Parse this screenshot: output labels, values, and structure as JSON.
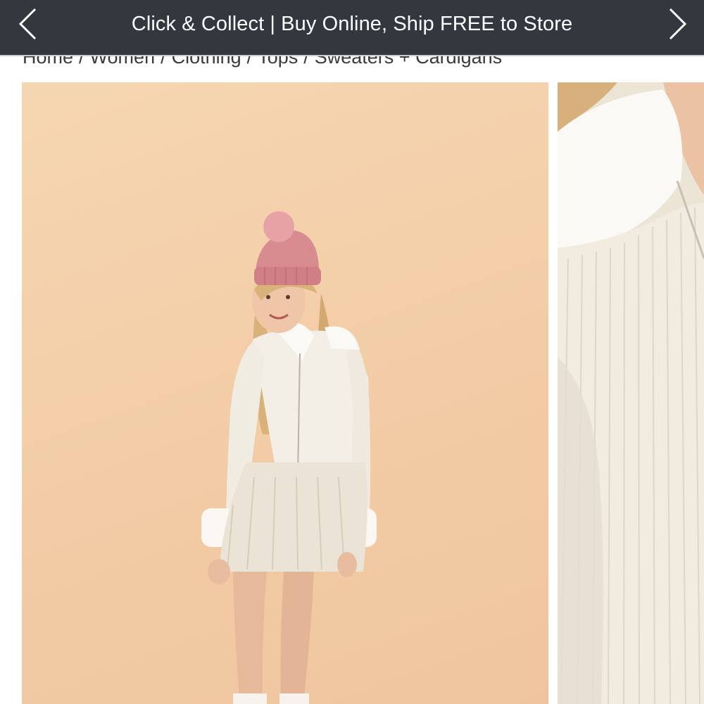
{
  "promo": {
    "text": "Click & Collect | Buy Online, Ship FREE to Store",
    "prev_icon": "chevron-left-icon",
    "next_icon": "chevron-right-icon",
    "background": "#33383f",
    "text_color": "#ffffff"
  },
  "breadcrumb": {
    "items": [
      "Home",
      "Women",
      "Clothing",
      "Tops",
      "Sweaters + Cardigans"
    ],
    "separator": "/"
  },
  "gallery": {
    "images": [
      {
        "name": "product-image-main"
      },
      {
        "name": "product-image-detail"
      }
    ],
    "background_color": "#f4d1ab"
  }
}
